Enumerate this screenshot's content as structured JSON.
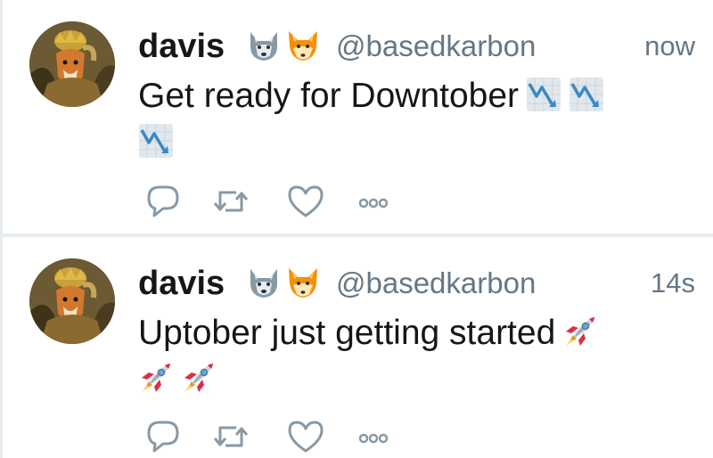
{
  "tweets": [
    {
      "author_name": "davis",
      "author_emojis": [
        "wolf-face-emoji",
        "fox-face-emoji"
      ],
      "handle": "@basedkarbon",
      "time": "now",
      "text": "Get ready for Downtober",
      "text_emojis": [
        "chart-decreasing-emoji",
        "chart-decreasing-emoji",
        "chart-decreasing-emoji"
      ],
      "actions": [
        "reply-icon",
        "retweet-icon",
        "like-icon",
        "more-icon"
      ]
    },
    {
      "author_name": "davis",
      "author_emojis": [
        "wolf-face-emoji",
        "fox-face-emoji"
      ],
      "handle": "@basedkarbon",
      "time": "14s",
      "text": "Uptober just getting started",
      "text_emojis": [
        "rocket-emoji",
        "rocket-emoji",
        "rocket-emoji"
      ],
      "actions": [
        "reply-icon",
        "retweet-icon",
        "like-icon",
        "more-icon"
      ]
    }
  ],
  "colors": {
    "text_primary": "#14171a",
    "text_secondary": "#657786",
    "divider": "#e6ecf0",
    "icon": "#8899a6"
  }
}
